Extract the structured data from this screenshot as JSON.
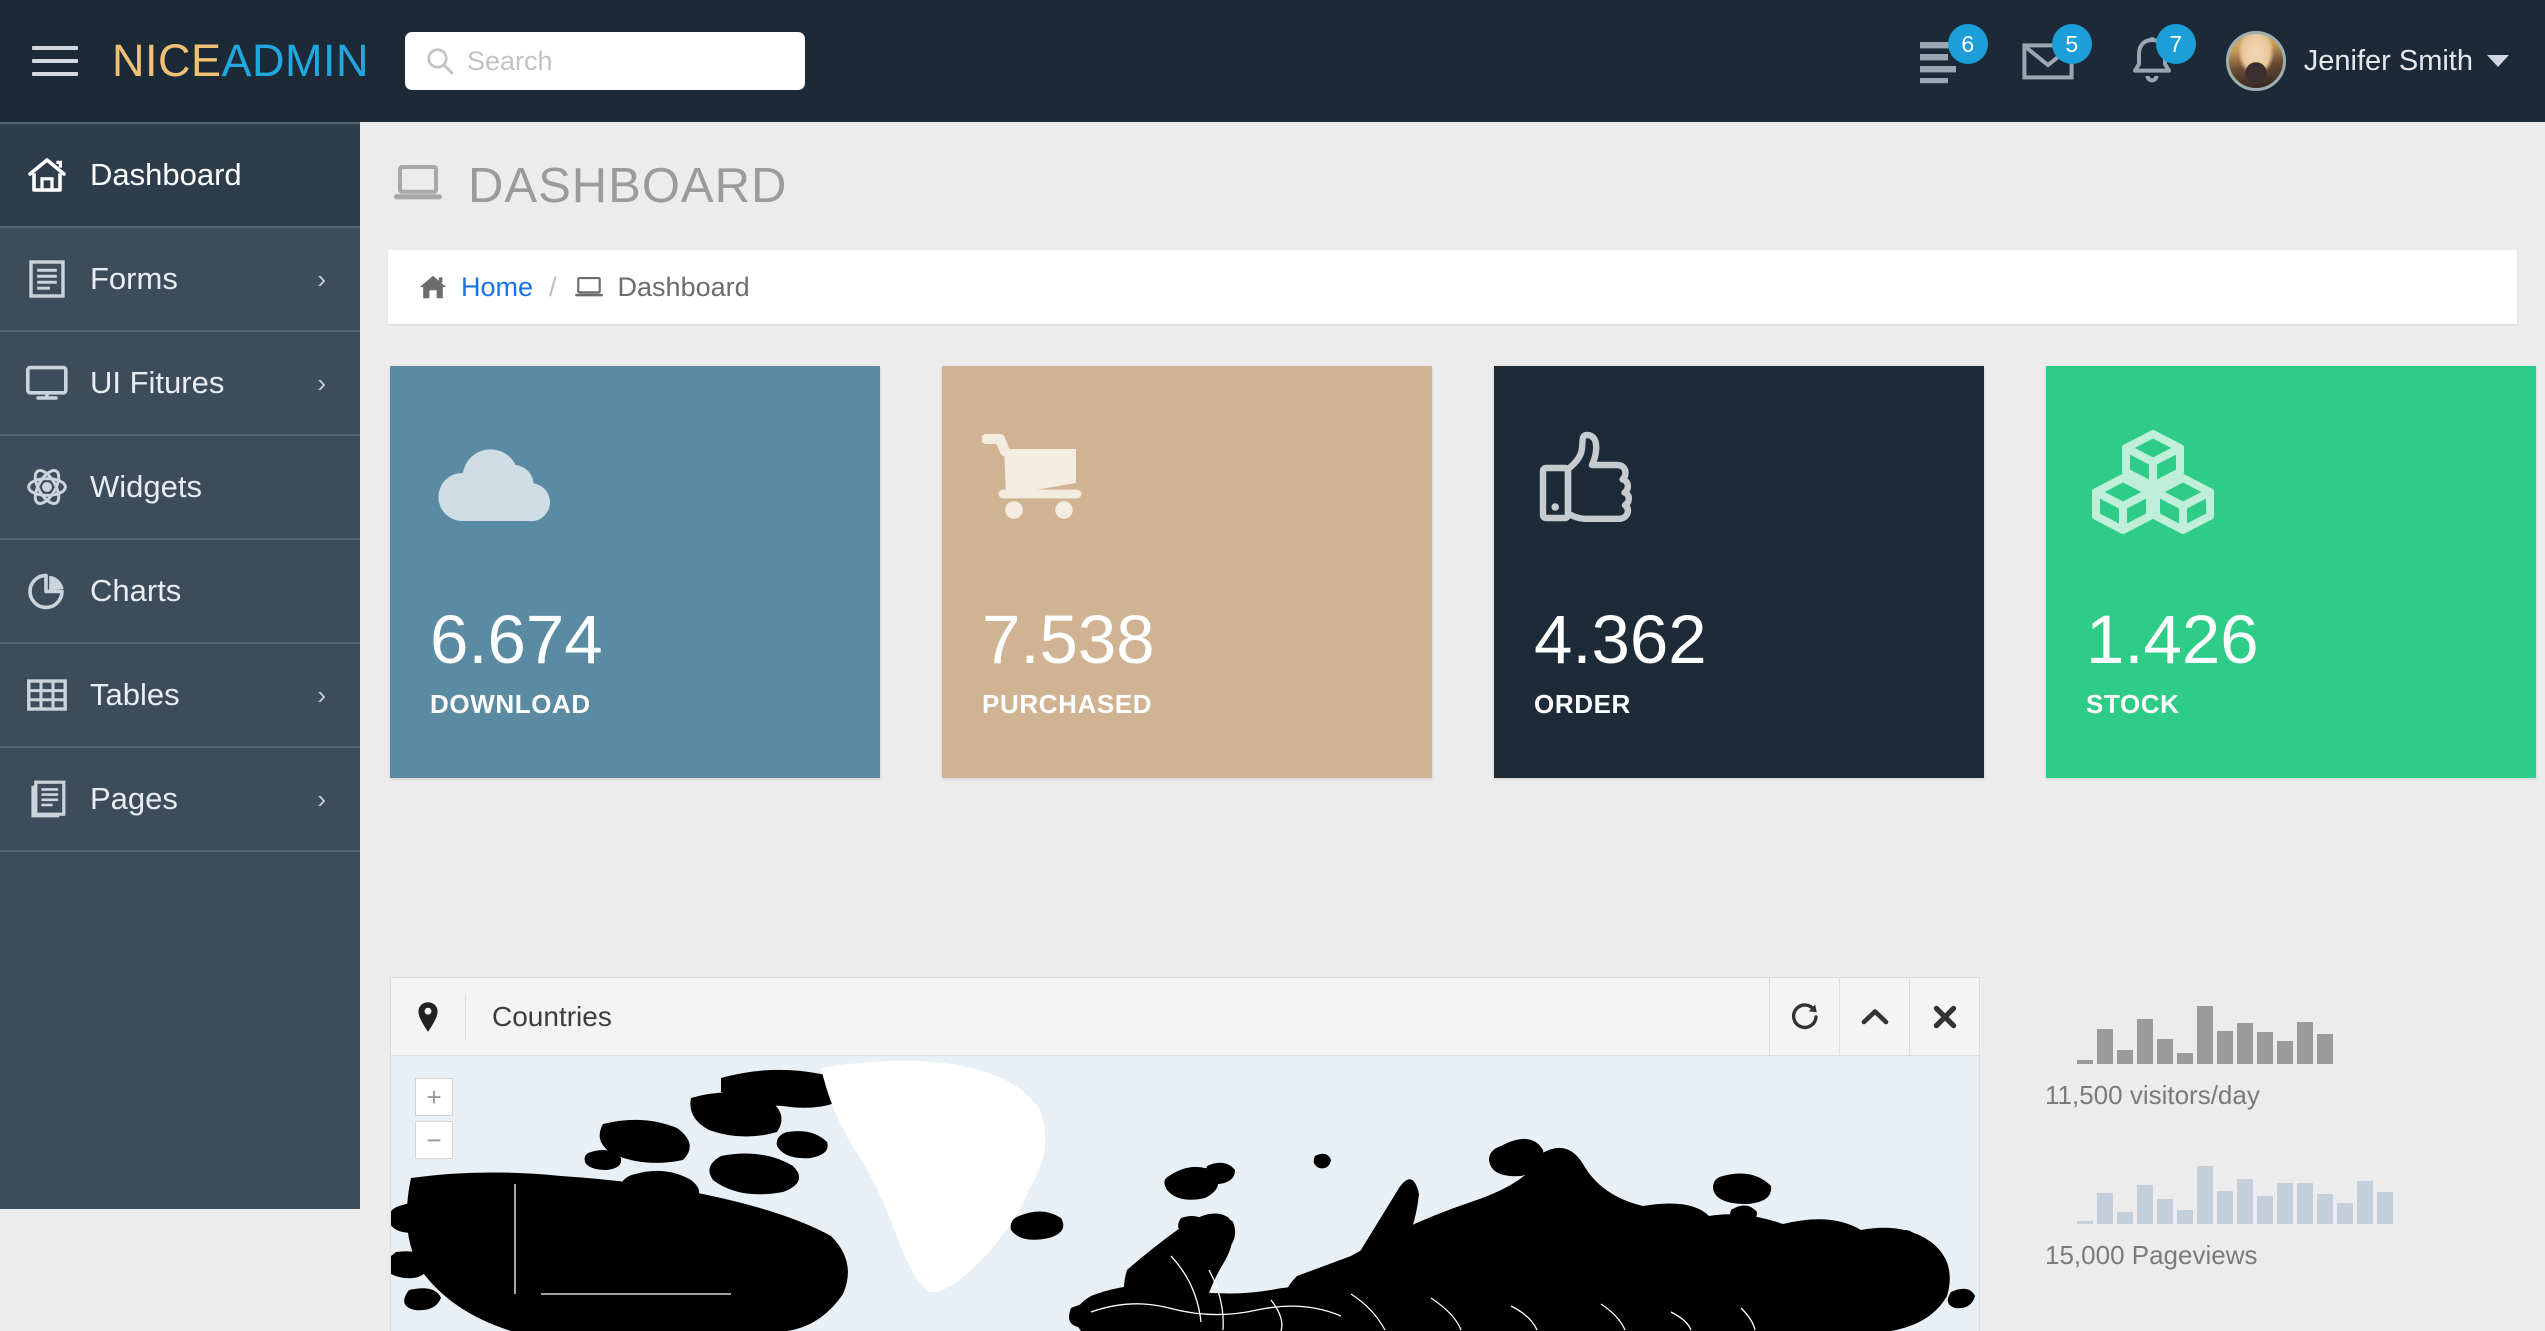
{
  "brand": {
    "part1": "NICE",
    "part2": "ADMIN"
  },
  "search": {
    "placeholder": "Search",
    "value": "",
    "icon": "search-icon"
  },
  "navbar": {
    "hamburger_icon": "hamburger-icon",
    "icons": [
      {
        "name": "tasks-icon",
        "badge": "6"
      },
      {
        "name": "envelope-icon",
        "badge": "5"
      },
      {
        "name": "bell-icon",
        "badge": "7"
      }
    ],
    "user": {
      "name": "Jenifer Smith",
      "avatar": "user-avatar",
      "caret": "caret-down-icon"
    }
  },
  "sidebar": {
    "items": [
      {
        "label": "Dashboard",
        "icon": "home-icon",
        "active": true,
        "chevron": ""
      },
      {
        "label": "Forms",
        "icon": "form-icon",
        "active": false,
        "chevron": "›"
      },
      {
        "label": "UI Fitures",
        "icon": "monitor-icon",
        "active": false,
        "chevron": "›"
      },
      {
        "label": "Widgets",
        "icon": "atom-icon",
        "active": false,
        "chevron": ""
      },
      {
        "label": "Charts",
        "icon": "pie-chart-icon",
        "active": false,
        "chevron": ""
      },
      {
        "label": "Tables",
        "icon": "table-icon",
        "active": false,
        "chevron": "›"
      },
      {
        "label": "Pages",
        "icon": "pages-icon",
        "active": false,
        "chevron": "›"
      }
    ]
  },
  "page": {
    "title": "DASHBOARD",
    "title_icon": "laptop-icon",
    "breadcrumb": {
      "home_icon": "home-icon",
      "home_label": "Home",
      "separator": "/",
      "current_icon": "laptop-icon",
      "current_label": "Dashboard"
    }
  },
  "stat_cards": [
    {
      "value": "6.674",
      "label": "DOWNLOAD",
      "icon": "cloud-download-icon",
      "bg": "#5a8ba3",
      "icon_color": "#cfdde4"
    },
    {
      "value": "7.538",
      "label": "PURCHASED",
      "icon": "shopping-cart-icon",
      "bg": "#cfb393",
      "icon_color": "#f5ece1"
    },
    {
      "value": "4.362",
      "label": "ORDER",
      "icon": "thumbs-up-icon",
      "bg": "#1d2b39",
      "icon_color": "#c6cbd0"
    },
    {
      "value": "1.426",
      "label": "STOCK",
      "icon": "cubes-icon",
      "bg": "#2ecc87",
      "icon_color": "#bfeeda"
    }
  ],
  "countries_panel": {
    "title": "Countries",
    "pin_icon": "map-marker-icon",
    "actions": [
      {
        "name": "refresh-button",
        "icon": "refresh-icon"
      },
      {
        "name": "collapse-button",
        "icon": "chevron-up-icon"
      },
      {
        "name": "close-button",
        "icon": "close-icon"
      }
    ],
    "map": {
      "zoom_in": "+",
      "zoom_out": "−",
      "ocean_color": "#e9f0f5",
      "land_color": "#000000"
    }
  },
  "chart_data": [
    {
      "type": "bar",
      "title": "11,500 visitors/day",
      "values": [
        4,
        34,
        14,
        44,
        24,
        11,
        56,
        32,
        40,
        31,
        22,
        41,
        29
      ],
      "color": "#9a9a9a",
      "ylim": [
        0,
        60
      ],
      "xlabel": "",
      "ylabel": ""
    },
    {
      "type": "bar",
      "title": "15,000 Pageviews",
      "values": [
        3,
        30,
        12,
        38,
        24,
        14,
        56,
        32,
        44,
        27,
        40,
        40,
        29,
        20,
        42,
        31
      ],
      "color": "#c3cfdb",
      "ylim": [
        0,
        60
      ],
      "xlabel": "",
      "ylabel": ""
    }
  ],
  "sparklines": [
    {
      "label": "11,500 visitors/day"
    },
    {
      "label": "15,000 Pageviews"
    }
  ],
  "colors": {
    "navbar_bg": "#1c2936",
    "sidebar_bg": "#3c4c5a",
    "sidebar_active_bg": "#2e3d4c",
    "content_bg": "#ececec",
    "accent_blue": "#22a7e0",
    "link_blue": "#1a73e8",
    "brand_gold": "#f0c074"
  }
}
